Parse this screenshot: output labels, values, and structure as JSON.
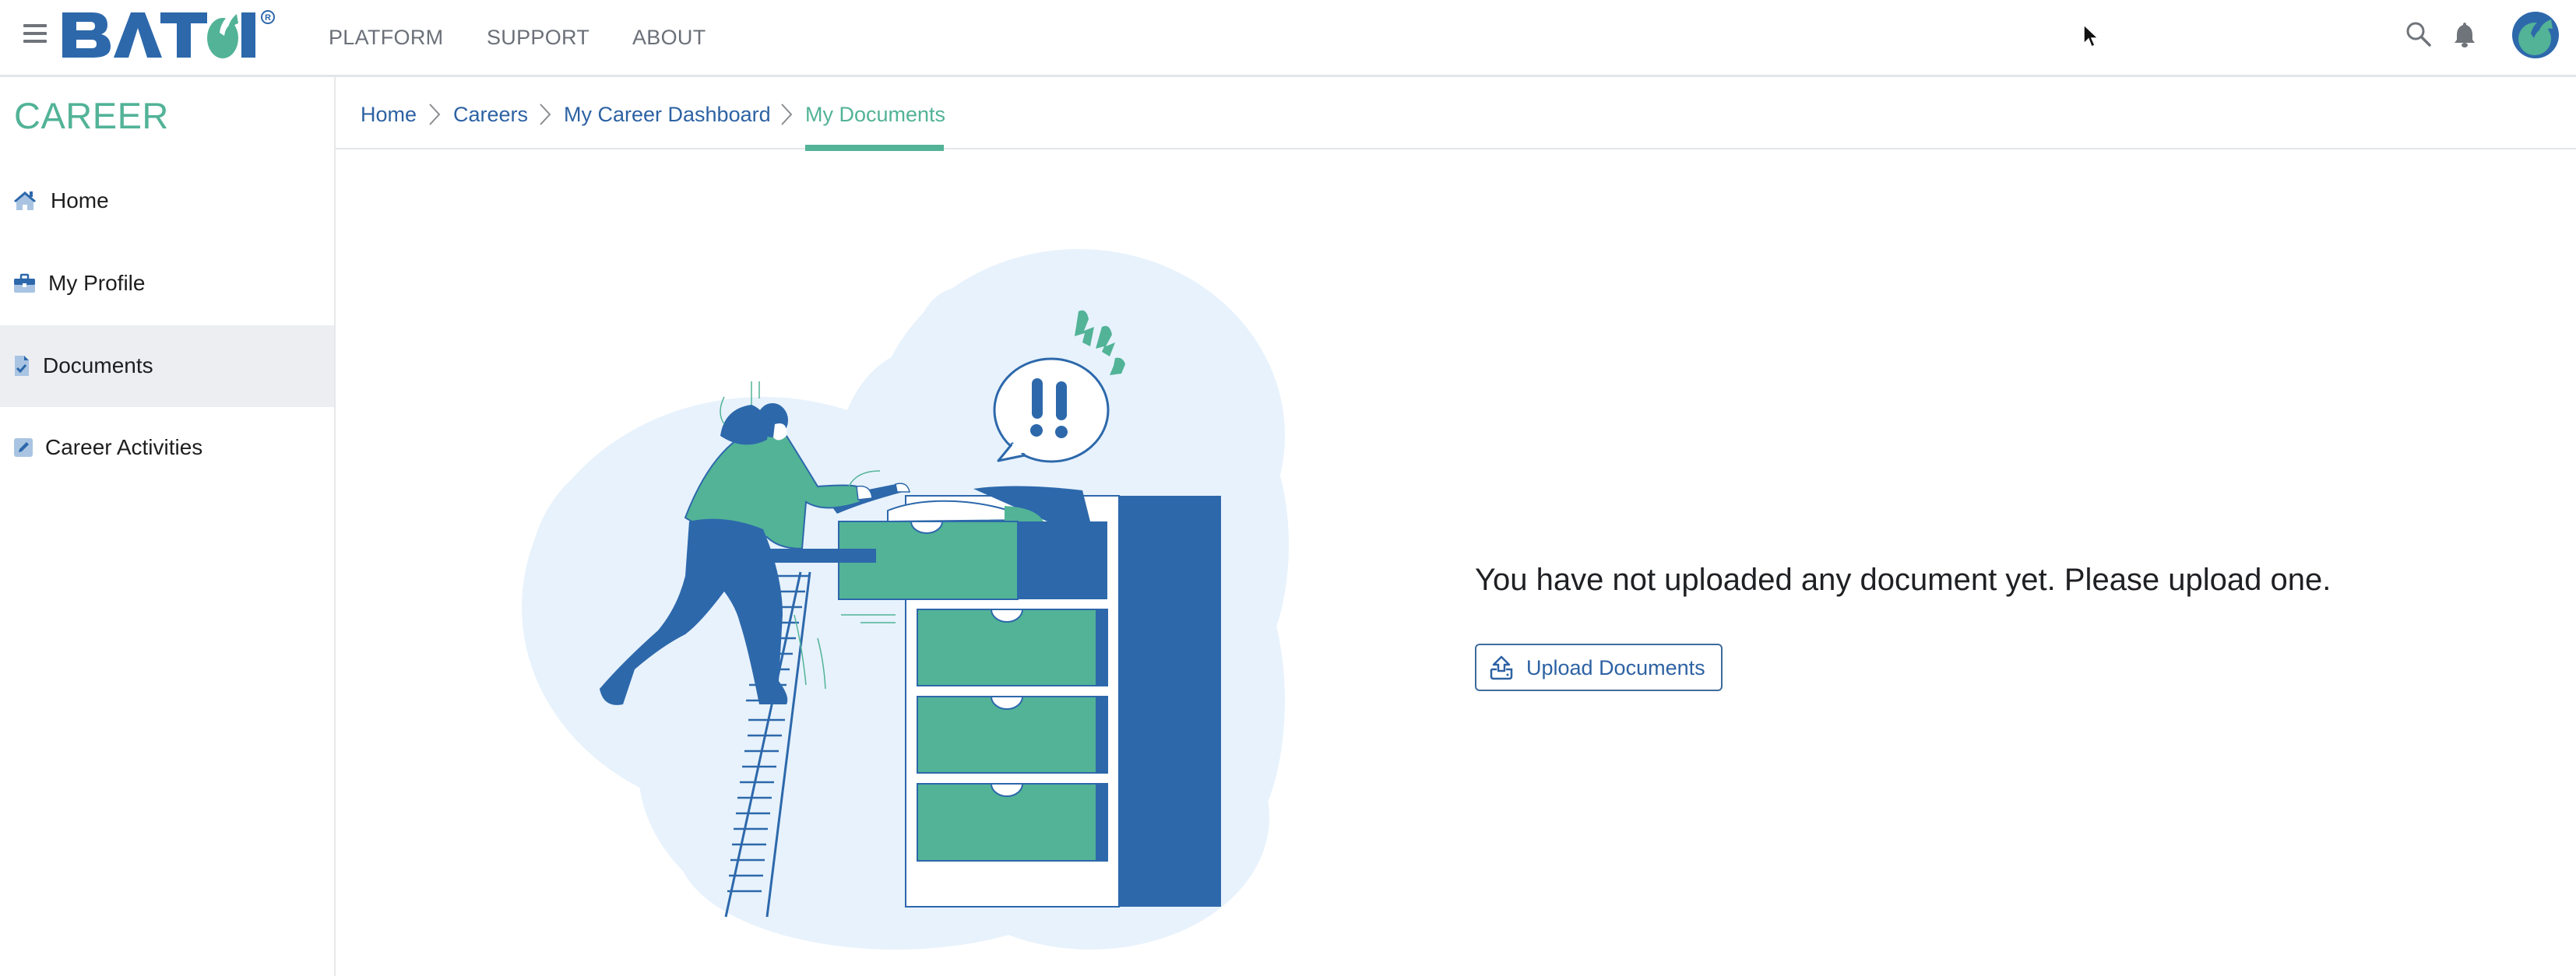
{
  "header": {
    "brand": "BATOI",
    "nav": [
      {
        "label": "PLATFORM"
      },
      {
        "label": "SUPPORT"
      },
      {
        "label": "ABOUT"
      }
    ],
    "icons": [
      "menu-icon",
      "search-icon",
      "bell-icon",
      "avatar"
    ]
  },
  "sidebar": {
    "title": "CAREER",
    "items": [
      {
        "label": "Home",
        "icon": "home-icon",
        "active": false
      },
      {
        "label": "My Profile",
        "icon": "briefcase-icon",
        "active": false
      },
      {
        "label": "Documents",
        "icon": "document-check-icon",
        "active": true
      },
      {
        "label": "Career Activities",
        "icon": "edit-icon",
        "active": false
      }
    ]
  },
  "breadcrumb": [
    {
      "label": "Home"
    },
    {
      "label": "Careers"
    },
    {
      "label": "My Career Dashboard"
    },
    {
      "label": "My Documents",
      "current": true
    }
  ],
  "main": {
    "empty_message": "You have not uploaded any document yet. Please upload one.",
    "upload_button": "Upload Documents"
  },
  "colors": {
    "brand_blue": "#2d68ab",
    "brand_green": "#52b397",
    "active_bg": "#eceef2",
    "cloud": "#e7f2fc"
  }
}
